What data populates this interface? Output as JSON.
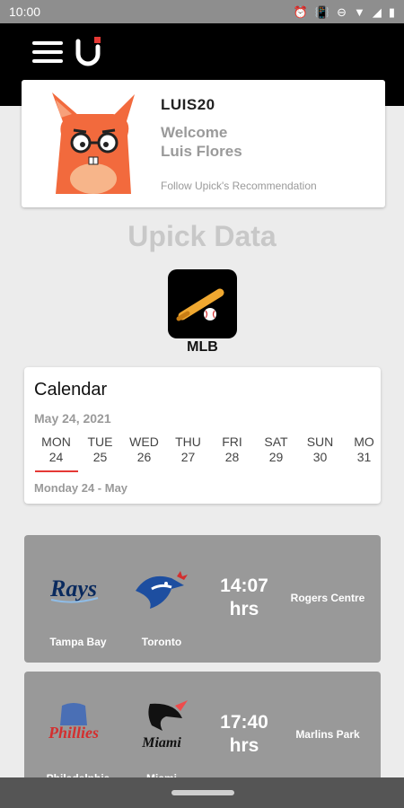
{
  "status_bar": {
    "time": "10:00",
    "icons": [
      "alarm-icon",
      "vibrate-icon",
      "dnd-icon",
      "wifi-icon",
      "signal-icon",
      "battery-icon"
    ]
  },
  "app_bar": {
    "menu_icon": "hamburger-menu-icon",
    "logo": "upick-logo"
  },
  "profile": {
    "username": "LUIS20",
    "welcome": "Welcome",
    "name": "Luis Flores",
    "tagline": "Follow Upick's Recommendation"
  },
  "section_title": "Upick Data",
  "sport": {
    "label": "MLB",
    "icon": "baseball-bat-icon"
  },
  "calendar": {
    "title": "Calendar",
    "date": "May 24, 2021",
    "days": [
      {
        "dow": "MON",
        "num": "24"
      },
      {
        "dow": "TUE",
        "num": "25"
      },
      {
        "dow": "WED",
        "num": "26"
      },
      {
        "dow": "THU",
        "num": "27"
      },
      {
        "dow": "FRI",
        "num": "28"
      },
      {
        "dow": "SAT",
        "num": "29"
      },
      {
        "dow": "SUN",
        "num": "30"
      },
      {
        "dow": "MO",
        "num": "31"
      }
    ],
    "selected_index": 0,
    "selected_label": "Monday 24 - May"
  },
  "matches": [
    {
      "home": "Tampa Bay",
      "away": "Toronto",
      "time": "14:07",
      "unit": "hrs",
      "venue": "Rogers Centre"
    },
    {
      "home": "Philadelphia",
      "away": "Miami",
      "time": "17:40",
      "unit": "hrs",
      "venue": "Marlins Park"
    }
  ],
  "colors": {
    "accent": "#e53935",
    "app_bar": "#000000",
    "card_gray": "#999999",
    "muted_text": "#9a9a9a"
  }
}
